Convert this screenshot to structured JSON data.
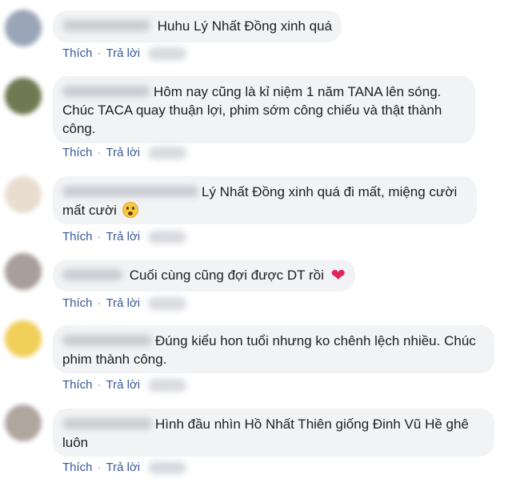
{
  "actions": {
    "like": "Thích",
    "reply": "Trả lời",
    "separator": "·"
  },
  "colors": {
    "bubble": "#f2f3f5",
    "link": "#385898",
    "heart": "#e0245e"
  },
  "comments": [
    {
      "text": "Huhu Lý Nhất Đồng xinh quá",
      "avatar_color": "#9aa6b8"
    },
    {
      "text_line1": "Hôm nay cũng là kỉ niệm 1 năm TANA lên sóng.",
      "text_line2": "Chúc TACA quay thuận lợi, phim sớm công chiếu và thật thành",
      "text_line3": "công.",
      "avatar_color": "#6f7a52"
    },
    {
      "text_line1": "Lý Nhất Đồng xinh quá đi mất, miệng cười",
      "text_line2": "mất cười",
      "emoji": "hushed-face-emoji",
      "avatar_color": "#e9ddd0"
    },
    {
      "text": "Cuối cùng cũng đợi được DT rồi",
      "emoji": "heart-emoji",
      "heart": "❤",
      "avatar_color": "#a89e9a"
    },
    {
      "text_line1": "Đúng kiểu hon tuổi nhưng ko chênh lệch nhiều. Chúc",
      "text_line2": "phim thành công.",
      "avatar_color": "#f0cf5a"
    },
    {
      "text_line1": "Hình đầu nhìn Hồ Nhất Thiên giống Đinh Vũ Hề ghê",
      "text_line2": "luôn",
      "avatar_color": "#b0a6a0"
    }
  ]
}
